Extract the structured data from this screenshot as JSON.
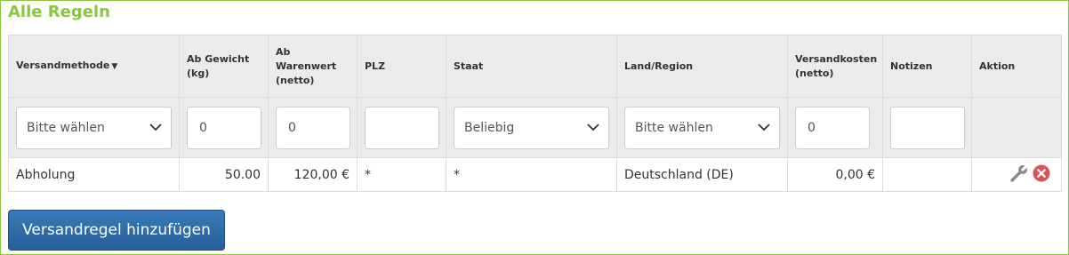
{
  "section": {
    "title": "Alle Regeln"
  },
  "table": {
    "headers": {
      "method": "Versandmethode",
      "weight": [
        "Ab Gewicht",
        "(kg)"
      ],
      "value": [
        "Ab",
        "Warenwert",
        "(netto)"
      ],
      "plz": "PLZ",
      "state": "Staat",
      "country": "Land/Region",
      "cost": [
        "Versandkosten",
        "(netto)"
      ],
      "notes": "Notizen",
      "action": "Aktion"
    },
    "filters": {
      "method": "Bitte wählen",
      "weight": "0",
      "value": "0",
      "plz": "",
      "state": "Beliebig",
      "country": "Bitte wählen",
      "cost": "0",
      "notes": ""
    },
    "rows": [
      {
        "method": "Abholung",
        "weight": "50.00",
        "value": "120,00 €",
        "plz": "*",
        "state": "*",
        "country": "Deutschland (DE)",
        "cost": "0,00 €",
        "notes": ""
      }
    ]
  },
  "add_button": {
    "label": "Versandregel hinzufügen"
  },
  "icons": {
    "edit": "wrench-icon",
    "delete": "delete-icon",
    "dropdown": "chevron-down-icon",
    "sort": "caret-down-icon"
  },
  "colors": {
    "accent": "#8cc63f",
    "button": "#2d6aa6",
    "delete": "#d9534f",
    "wrench": "#8a8a8a"
  }
}
